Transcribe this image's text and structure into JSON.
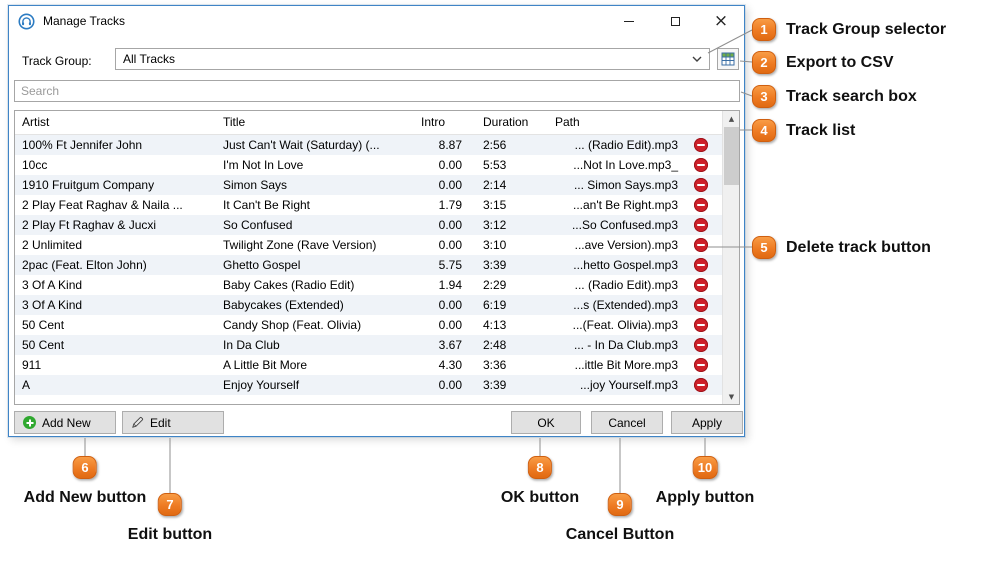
{
  "window": {
    "title": "Manage Tracks"
  },
  "toolbar": {
    "track_group_label": "Track Group:",
    "track_group_value": "All Tracks"
  },
  "search": {
    "placeholder": "Search"
  },
  "table": {
    "columns": [
      "Artist",
      "Title",
      "Intro",
      "Duration",
      "Path"
    ],
    "rows": [
      {
        "artist": "100% Ft Jennifer John",
        "title": "Just Can't Wait (Saturday) (...",
        "intro": "8.87",
        "duration": "2:56",
        "path": "... (Radio Edit).mp3"
      },
      {
        "artist": "10cc",
        "title": "I'm Not In Love",
        "intro": "0.00",
        "duration": "5:53",
        "path": "...Not In Love.mp3_"
      },
      {
        "artist": "1910 Fruitgum Company",
        "title": "Simon Says",
        "intro": "0.00",
        "duration": "2:14",
        "path": "... Simon Says.mp3"
      },
      {
        "artist": "2 Play Feat Raghav & Naila ...",
        "title": "It Can't Be Right",
        "intro": "1.79",
        "duration": "3:15",
        "path": "...an't Be Right.mp3"
      },
      {
        "artist": "2 Play Ft Raghav & Jucxi",
        "title": "So Confused",
        "intro": "0.00",
        "duration": "3:12",
        "path": "...So Confused.mp3"
      },
      {
        "artist": "2 Unlimited",
        "title": "Twilight Zone (Rave Version)",
        "intro": "0.00",
        "duration": "3:10",
        "path": "...ave Version).mp3"
      },
      {
        "artist": "2pac (Feat. Elton John)",
        "title": "Ghetto Gospel",
        "intro": "5.75",
        "duration": "3:39",
        "path": "...hetto Gospel.mp3"
      },
      {
        "artist": "3 Of A Kind",
        "title": "Baby Cakes (Radio Edit)",
        "intro": "1.94",
        "duration": "2:29",
        "path": "... (Radio Edit).mp3"
      },
      {
        "artist": "3 Of A Kind",
        "title": "Babycakes (Extended)",
        "intro": "0.00",
        "duration": "6:19",
        "path": "...s (Extended).mp3"
      },
      {
        "artist": "50 Cent",
        "title": "Candy Shop (Feat. Olivia)",
        "intro": "0.00",
        "duration": "4:13",
        "path": "...(Feat. Olivia).mp3"
      },
      {
        "artist": "50 Cent",
        "title": "In Da Club",
        "intro": "3.67",
        "duration": "2:48",
        "path": "... - In Da Club.mp3"
      },
      {
        "artist": "911",
        "title": "A Little Bit More",
        "intro": "4.30",
        "duration": "3:36",
        "path": "...ittle Bit More.mp3"
      },
      {
        "artist": "A",
        "title": "Enjoy Yourself",
        "intro": "0.00",
        "duration": "3:39",
        "path": "...joy Yourself.mp3"
      }
    ]
  },
  "buttons": {
    "add_new": "Add New",
    "edit": "Edit",
    "ok": "OK",
    "cancel": "Cancel",
    "apply": "Apply"
  },
  "annotations": [
    {
      "num": "1",
      "label": "Track Group selector"
    },
    {
      "num": "2",
      "label": "Export to CSV"
    },
    {
      "num": "3",
      "label": "Track search box"
    },
    {
      "num": "4",
      "label": "Track list"
    },
    {
      "num": "5",
      "label": "Delete track button"
    },
    {
      "num": "6",
      "label": "Add New button"
    },
    {
      "num": "7",
      "label": "Edit button"
    },
    {
      "num": "8",
      "label": "OK button"
    },
    {
      "num": "9",
      "label": "Cancel Button"
    },
    {
      "num": "10",
      "label": "Apply button"
    }
  ],
  "icons": {
    "close": "×",
    "scroll_up": "▲",
    "scroll_down": "▼"
  },
  "colors": {
    "badge_orange": "#EE7B23",
    "delete_red": "#CE2029",
    "dialog_border": "#3F84C6",
    "accent_green": "#2FA82F"
  }
}
